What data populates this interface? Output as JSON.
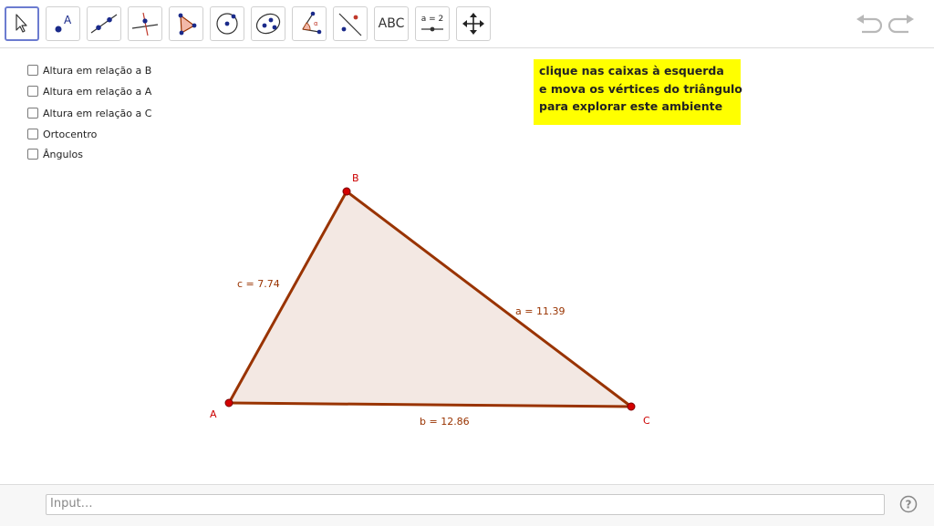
{
  "toolbar": {
    "tools": [
      {
        "name": "move-tool",
        "icon": "cursor-arrow-icon"
      },
      {
        "name": "point-tool",
        "icon": "point-icon"
      },
      {
        "name": "line-tool",
        "icon": "line-through-points-icon"
      },
      {
        "name": "perpendicular-line-tool",
        "icon": "perpendicular-line-icon"
      },
      {
        "name": "polygon-tool",
        "icon": "polygon-icon"
      },
      {
        "name": "circle-tool",
        "icon": "circle-center-point-icon"
      },
      {
        "name": "ellipse-tool",
        "icon": "ellipse-icon"
      },
      {
        "name": "angle-tool",
        "icon": "angle-icon"
      },
      {
        "name": "reflect-tool",
        "icon": "reflect-about-line-icon"
      },
      {
        "name": "text-tool",
        "icon": "text-icon",
        "label": "ABC"
      },
      {
        "name": "slider-tool",
        "icon": "slider-icon",
        "label": "a = 2"
      },
      {
        "name": "move-graphics-view-tool",
        "icon": "move-arrows-icon"
      }
    ],
    "undo_icon": "undo-icon",
    "redo_icon": "redo-icon"
  },
  "checkboxes": [
    {
      "label": "Altura em relação a B",
      "checked": false
    },
    {
      "label": "Altura em relação a A",
      "checked": false
    },
    {
      "label": "Altura em relação a C",
      "checked": false
    },
    {
      "label": "Ortocentro",
      "checked": false
    },
    {
      "label": "Ângulos",
      "checked": false
    }
  ],
  "note": {
    "lines": [
      "clique nas caixas à esquerda",
      "e mova os vértices do triângulo",
      "para explorar este ambiente"
    ],
    "background": "#ffff00"
  },
  "triangle": {
    "vertex_labels": {
      "A": "A",
      "B": "B",
      "C": "C"
    },
    "side_labels": {
      "a": "a = 11.39",
      "b": "b = 12.86",
      "c": "c = 7.74"
    },
    "edge_color": "#993300",
    "fill_color": "#f3e8e3",
    "vertex_color": "#d40000",
    "label_color": "#cc0000"
  },
  "input": {
    "placeholder": "Input…"
  },
  "help_icon": "help-icon"
}
